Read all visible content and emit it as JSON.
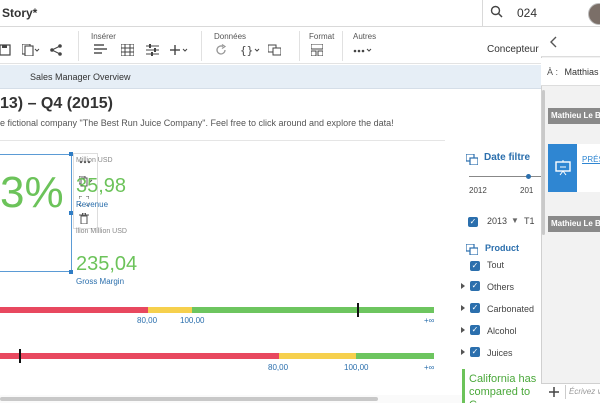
{
  "header": {
    "story_title": "Story*",
    "search_value": "024"
  },
  "toolbar": {
    "groups": [
      "Insérer",
      "Données",
      "Format",
      "Autres"
    ],
    "designer_label": "Concepteur"
  },
  "tab": {
    "label": "Sales Manager Overview"
  },
  "page": {
    "title": "13) – Q4 (2015)",
    "subtitle": "e fictional company \"The Best Run Juice Company\". Feel free to click around and explore the data!"
  },
  "kpi": {
    "percent_text": "3%",
    "revenue": {
      "sublabel": "Million USD",
      "value": "35,98",
      "name": "Revenue"
    },
    "gross_margin": {
      "sublabel": "llion Million USD",
      "value": "235,04",
      "name": "Gross Margin"
    }
  },
  "bullet_charts": [
    {
      "labels": [
        "80,00",
        "100,00",
        "+∞"
      ],
      "marker_value": 95
    },
    {
      "labels": [
        "80,00",
        "100,00",
        "+∞"
      ],
      "marker_value": 5
    }
  ],
  "filters": {
    "date": {
      "title": "Date filtre",
      "range_labels": [
        "2012",
        "201"
      ],
      "selected_year": "2013",
      "selected_quarter": "T1"
    },
    "product": {
      "title": "Product",
      "items": [
        {
          "label": "Tout",
          "checked": true,
          "expandable": false
        },
        {
          "label": "Others",
          "checked": true,
          "expandable": true
        },
        {
          "label": "Carbonated",
          "checked": true,
          "expandable": true
        },
        {
          "label": "Alcohol",
          "checked": true,
          "expandable": true
        },
        {
          "label": "Juices",
          "checked": true,
          "expandable": true
        }
      ]
    },
    "callout": "California has compared to C"
  },
  "side_panel": {
    "to_label": "À :",
    "to_name": "Matthias M",
    "messages": [
      {
        "author": "Mathieu Le Be"
      },
      {
        "author": "Mathieu Le Be"
      }
    ],
    "card_link": "PRÉS",
    "input_placeholder": "Écrivez v"
  },
  "colors": {
    "accent_blue": "#2b6fad",
    "kpi_green": "#6cc35a",
    "bar_red": "#e8485f",
    "bar_yellow": "#f6d04d",
    "bar_green": "#6dc55f"
  }
}
